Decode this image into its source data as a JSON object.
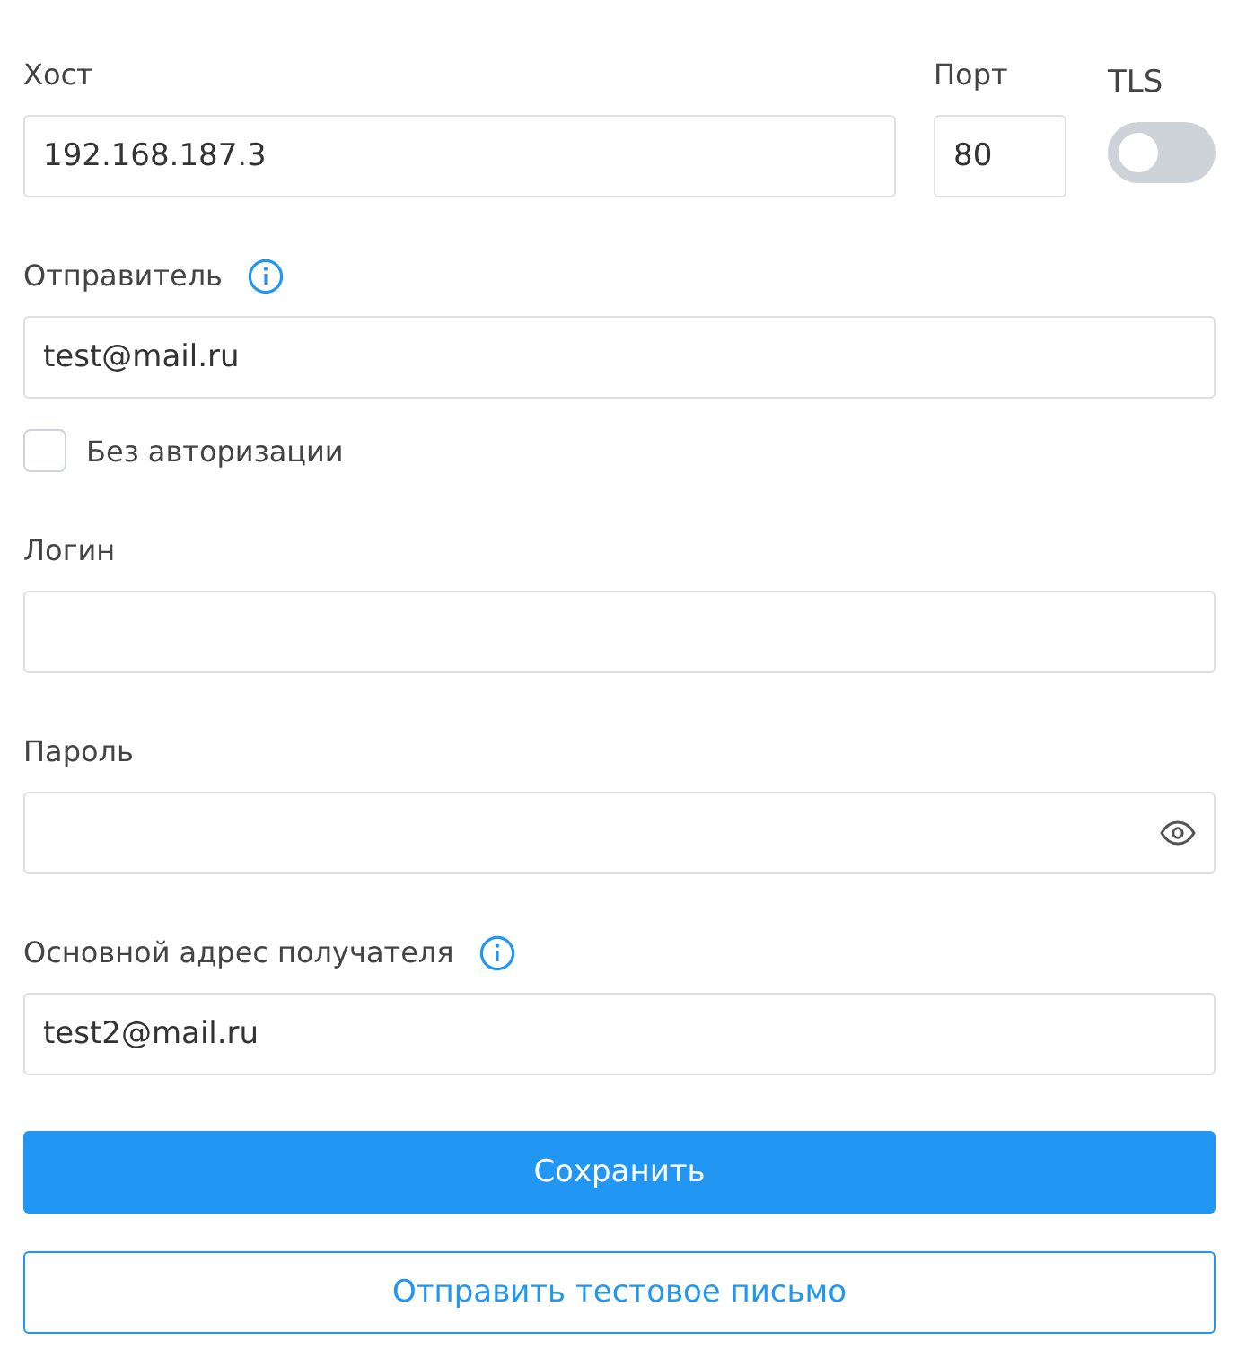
{
  "host": {
    "label": "Хост",
    "value": "192.168.187.3"
  },
  "port": {
    "label": "Порт",
    "value": "80"
  },
  "tls": {
    "label": "TLS",
    "on": false
  },
  "sender": {
    "label": "Отправитель",
    "value": "test@mail.ru"
  },
  "no_auth": {
    "label": "Без авторизации",
    "checked": false
  },
  "login": {
    "label": "Логин"
  },
  "password": {
    "label": "Пароль"
  },
  "recipient": {
    "label": "Основной адрес получателя",
    "value": "test2@mail.ru"
  },
  "buttons": [
    {
      "label": "Сохранить",
      "kind": "primary"
    },
    {
      "label": "Отправить тестовое письмо",
      "kind": "outline"
    }
  ]
}
